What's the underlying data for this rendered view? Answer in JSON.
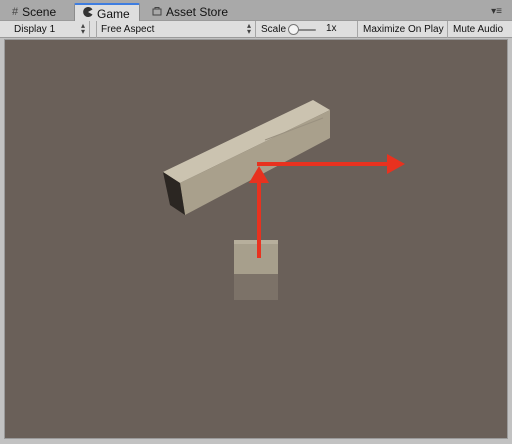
{
  "tabs": {
    "scene": {
      "label": "Scene",
      "icon": "grid-icon"
    },
    "game": {
      "label": "Game",
      "icon": "pacman-icon"
    },
    "asset_store": {
      "label": "Asset Store",
      "icon": "store-icon"
    }
  },
  "toolbar": {
    "display": "Display 1",
    "aspect": "Free Aspect",
    "scale_label": "Scale",
    "scale_value": "1x",
    "maximize": "Maximize On Play",
    "mute": "Mute Audio"
  },
  "colors": {
    "viewport_bg": "#6a6059",
    "arrow": "#e8321f",
    "object": "#bdb5a3",
    "active_tab_accent": "#3e7de0"
  }
}
